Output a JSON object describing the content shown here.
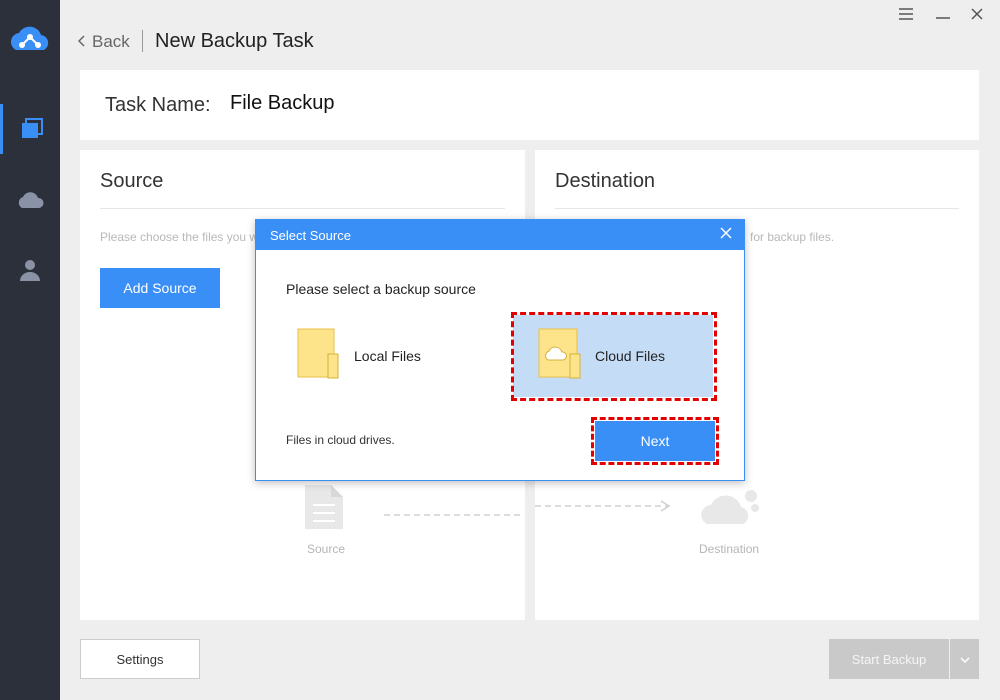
{
  "colors": {
    "accent": "#3a8ff6",
    "sidebar_bg": "#2b303b",
    "highlight": "#e20000",
    "selected_bg": "#c5dcf7"
  },
  "sidebar": {
    "items": [
      {
        "icon": "backup-icon",
        "active": true
      },
      {
        "icon": "cloud-icon",
        "active": false
      },
      {
        "icon": "user-icon",
        "active": false
      }
    ]
  },
  "window_controls": {
    "menu_icon": "menu-icon",
    "minimize_icon": "minimize-icon",
    "close_icon": "close-icon"
  },
  "header": {
    "back_label": "Back",
    "title": "New Backup Task"
  },
  "task": {
    "label": "Task Name:",
    "value": "File Backup"
  },
  "source_panel": {
    "title": "Source",
    "hint": "Please choose the files you w",
    "add_button": "Add Source",
    "flow_label": "Source"
  },
  "destination_panel": {
    "title": "Destination",
    "hint": "for backup files.",
    "flow_label": "Destination"
  },
  "footer": {
    "settings_label": "Settings",
    "start_label": "Start Backup"
  },
  "dialog": {
    "title": "Select Source",
    "prompt": "Please select a backup source",
    "options": [
      {
        "label": "Local Files",
        "icon": "folder-icon",
        "selected": false
      },
      {
        "label": "Cloud Files",
        "icon": "cloud-folder-icon",
        "selected": true
      }
    ],
    "description": "Files in cloud drives.",
    "next_label": "Next"
  }
}
